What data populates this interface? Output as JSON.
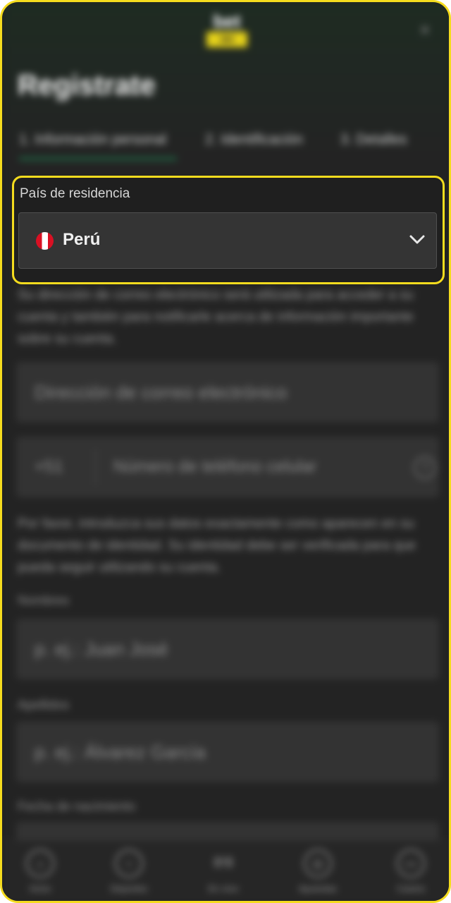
{
  "header": {
    "logo_top": "bet",
    "logo_bottom": "365",
    "close_glyph": "×"
  },
  "page": {
    "title": "Registrate"
  },
  "tabs": [
    {
      "label": "1. Información personal"
    },
    {
      "label": "2. Identificación"
    },
    {
      "label": "3. Detalles"
    }
  ],
  "country": {
    "label": "País de residencia",
    "value": "Perú",
    "flag": "peru-flag-icon"
  },
  "form": {
    "info_text": "Su dirección de correo electrónico será utilizada para acceder a su cuenta y también para notificarle acerca de información importante sobre su cuenta.",
    "email_placeholder": "Dirección de correo electrónico",
    "phone_prefix": "+51",
    "phone_placeholder": "Número de teléfono celular",
    "help_glyph": "?",
    "identity_text": "Por favor, introduzca sus datos exactamente como aparecen en su documento de identidad. Su identidad debe ser verificada para que pueda seguir utilizando su cuenta.",
    "name_label": "Nombres",
    "name_placeholder": "p. ej.: Juan José",
    "surname_label": "Apellidos",
    "surname_placeholder": "p. ej.: Álvarez García",
    "birth_label": "Fecha de nacimiento"
  },
  "bottom_nav": [
    {
      "label": "Inicio",
      "icon": "home-icon"
    },
    {
      "label": "Deportes",
      "icon": "search-icon"
    },
    {
      "label": "En vivo",
      "icon": "live-icon",
      "glyph": "((•))"
    },
    {
      "label": "Apuestas",
      "icon": "bets-icon"
    },
    {
      "label": "Casino",
      "icon": "casino-icon"
    }
  ],
  "colors": {
    "highlight": "#f5dc1e",
    "tab_active": "#1e6e47",
    "background": "#232323"
  }
}
